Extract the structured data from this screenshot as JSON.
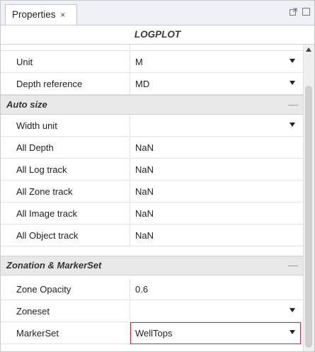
{
  "tab": {
    "label": "Properties",
    "close": "×"
  },
  "title": "LOGPLOT",
  "rows_top": [
    {
      "name": "Unit",
      "value": "M",
      "dropdown": true
    },
    {
      "name": "Depth reference",
      "value": "MD",
      "dropdown": true
    }
  ],
  "groups": [
    {
      "title": "Auto size",
      "collapse": "—",
      "rows": [
        {
          "name": "Width unit",
          "value": "",
          "dropdown": true
        },
        {
          "name": "All Depth",
          "value": "NaN",
          "dropdown": false
        },
        {
          "name": "All Log track",
          "value": "NaN",
          "dropdown": false
        },
        {
          "name": "All Zone track",
          "value": "NaN",
          "dropdown": false
        },
        {
          "name": "All Image track",
          "value": "NaN",
          "dropdown": false
        },
        {
          "name": "All Object track",
          "value": "NaN",
          "dropdown": false
        }
      ]
    },
    {
      "title": "Zonation & MarkerSet",
      "collapse": "—",
      "rows": [
        {
          "name": "Zone Opacity",
          "value": "0.6",
          "dropdown": false
        },
        {
          "name": "Zoneset",
          "value": "",
          "dropdown": true
        },
        {
          "name": "MarkerSet",
          "value": "WellTops",
          "dropdown": true,
          "selected": true
        }
      ]
    }
  ],
  "colors": {
    "selection_border": "#c8303a",
    "group_bg": "#e8e8e8"
  },
  "icons": {
    "window": [
      "popout-icon",
      "maximize-icon"
    ]
  }
}
